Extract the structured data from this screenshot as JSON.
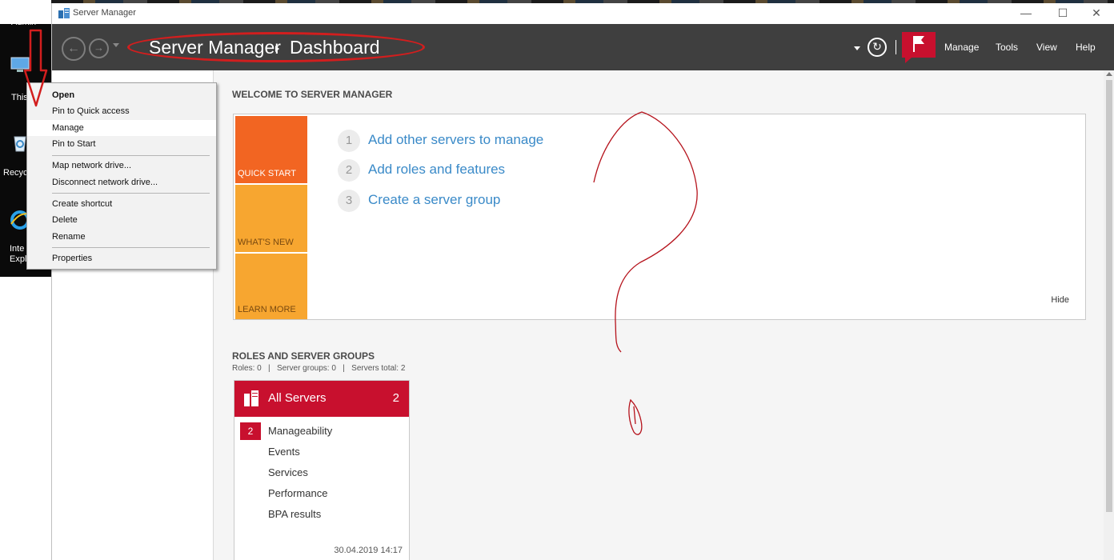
{
  "desktop": {
    "top_label": "Admin",
    "icons": [
      {
        "label": "This",
        "icon": "this-pc-icon"
      },
      {
        "label": "Recyc",
        "icon": "recycle-bin-icon"
      },
      {
        "label": "Inte",
        "label2": "Expl",
        "icon": "internet-explorer-icon"
      }
    ]
  },
  "window": {
    "title": "Server Manager",
    "controls": {
      "minimize": "—",
      "maximize": "☐",
      "close": "✕"
    }
  },
  "header": {
    "breadcrumb": [
      "Server Manager",
      "Dashboard"
    ],
    "menu": [
      "Manage",
      "Tools",
      "View",
      "Help"
    ]
  },
  "welcome": {
    "title": "WELCOME TO SERVER MANAGER",
    "tiles": [
      "QUICK START",
      "WHAT'S NEW",
      "LEARN MORE"
    ],
    "steps": [
      {
        "num": "1",
        "label": "Add other servers to manage"
      },
      {
        "num": "2",
        "label": "Add roles and features"
      },
      {
        "num": "3",
        "label": "Create a server group"
      }
    ],
    "hide": "Hide"
  },
  "roles": {
    "title": "ROLES AND SERVER GROUPS",
    "summary": "Roles: 0   |   Server groups: 0   |   Servers total: 2",
    "card": {
      "title": "All Servers",
      "count": "2",
      "badge": "2",
      "rows": [
        "Manageability",
        "Events",
        "Services",
        "Performance",
        "BPA results"
      ],
      "timestamp": "30.04.2019 14:17"
    }
  },
  "context_menu": {
    "items": [
      {
        "label": "Open",
        "bold": true
      },
      {
        "label": "Pin to Quick access"
      },
      {
        "label": "Manage",
        "highlighted": true
      },
      {
        "label": "Pin to Start"
      },
      {
        "label": "Map network drive..."
      },
      {
        "label": "Disconnect network drive..."
      },
      {
        "label": "Create shortcut"
      },
      {
        "label": "Delete"
      },
      {
        "label": "Rename"
      },
      {
        "label": "Properties"
      }
    ]
  },
  "colors": {
    "header_bg": "#3f3f3f",
    "accent_red": "#c8102e",
    "quick_start": "#f26522",
    "tile_orange": "#f7a630",
    "link_blue": "#3a8ac8",
    "annotation_red": "#d21e1e"
  }
}
